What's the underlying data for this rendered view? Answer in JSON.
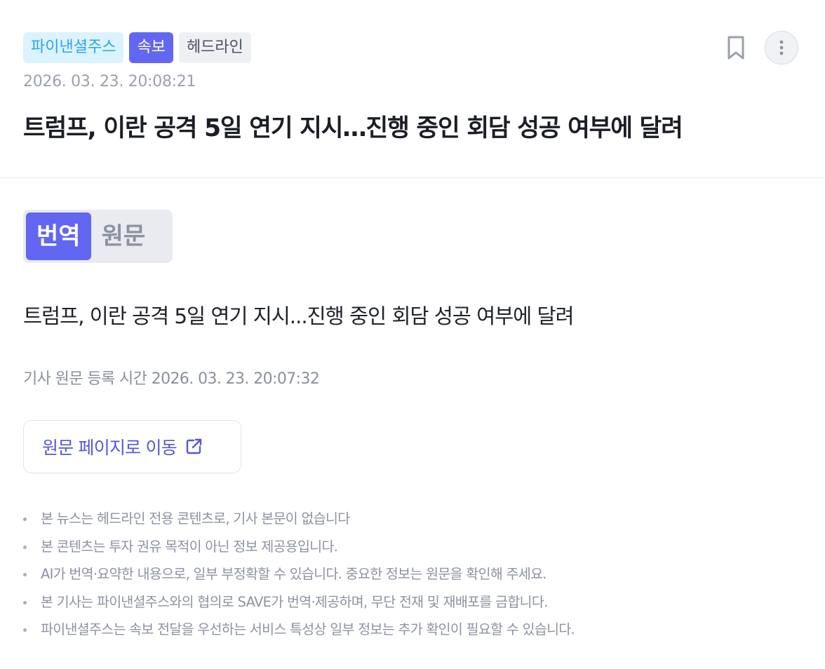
{
  "article": {
    "tags": {
      "source": "파이낸셜주스",
      "breaking": "속보",
      "headline": "헤드라인"
    },
    "timestamp": "2026. 03. 23. 20:08:21",
    "title": "트럼프, 이란 공격 5일 연기 지시…진행 중인 회담 성공 여부에 달려"
  },
  "toolbar": {
    "bookmark_icon": "bookmark-icon",
    "more_icon": "more-vertical-icon"
  },
  "toggle": {
    "translated_label": "번역",
    "original_label": "원문",
    "selected": "번역"
  },
  "content": {
    "translated_title": "트럼프, 이란 공격 5일 연기 지시...진행 중인 회담 성공 여부에 달려",
    "original_time": "기사 원문 등록 시간 2026. 03. 23. 20:07:32"
  },
  "link_button": {
    "label": "원문 페이지로 이동",
    "icon": "external-link-icon"
  },
  "notes": [
    "본 뉴스는 헤드라인 전용 콘텐츠로, 기사 본문이 없습니다",
    "본 콘텐츠는 투자 권유 목적이 아닌 정보 제공용입니다.",
    "AI가 번역·요약한 내용으로, 일부 부정확할 수 있습니다. 중요한 정보는 원문을 확인해 주세요.",
    "본 기사는 파이낸셜주스와의 협의로 SAVE가 번역·제공하며, 무단 전재 및 재배포를 금합니다.",
    "파이낸셜주스는 속보 전달을 우선하는 서비스 특성상 일부 정보는 추가 확인이 필요할 수 있습니다."
  ],
  "colors": {
    "accent": "#6366f1",
    "source_tag_bg": "#dbf3ff",
    "source_tag_text": "#2aa6e8",
    "link_text": "#5856d6"
  }
}
